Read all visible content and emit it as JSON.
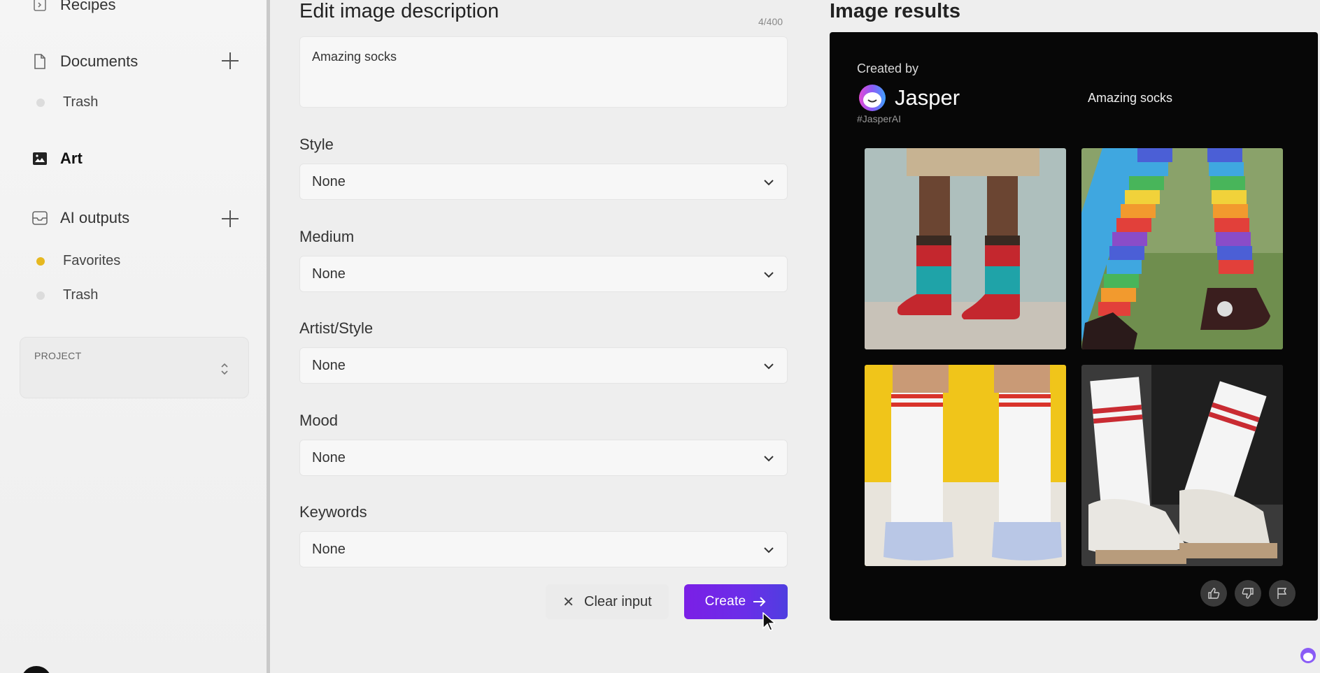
{
  "sidebar": {
    "recipes_label": "Recipes",
    "documents_label": "Documents",
    "documents_trash": "Trash",
    "art_label": "Art",
    "ai_outputs_label": "AI outputs",
    "favorites_label": "Favorites",
    "ai_trash": "Trash",
    "project_label": "PROJECT"
  },
  "form": {
    "title": "Edit image description",
    "counter": "4/400",
    "description": "Amazing socks",
    "fields": [
      {
        "label": "Style",
        "value": "None"
      },
      {
        "label": "Medium",
        "value": "None"
      },
      {
        "label": "Artist/Style",
        "value": "None"
      },
      {
        "label": "Mood",
        "value": "None"
      },
      {
        "label": "Keywords",
        "value": "None"
      }
    ],
    "clear_label": "Clear input",
    "create_label": "Create"
  },
  "results": {
    "title": "Image results",
    "created_by": "Created by",
    "brand": "Jasper",
    "hashtag": "#JasperAI",
    "caption": "Amazing socks"
  },
  "colors": {
    "accent": "#6a2ee8",
    "favorites_dot": "#e6b820",
    "panel_bg": "#070707"
  }
}
